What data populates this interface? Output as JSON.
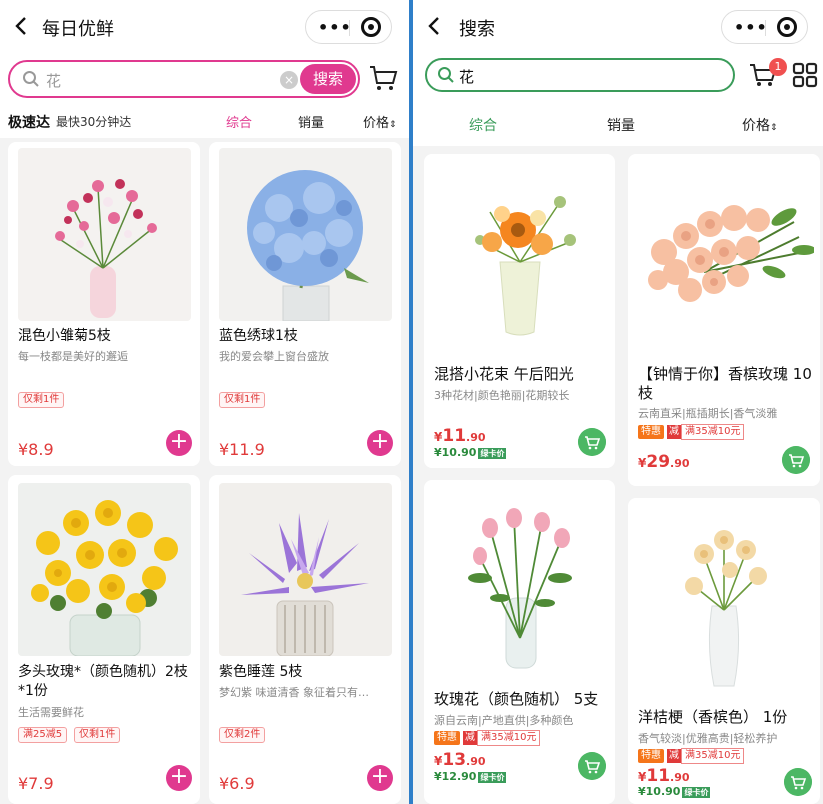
{
  "left": {
    "title": "每日优鲜",
    "search": {
      "value": "花",
      "button": "搜索"
    },
    "delivery": {
      "name": "极速达",
      "sub": "最快30分钟达"
    },
    "sort": [
      "综合",
      "销量",
      "价格"
    ],
    "colors": {
      "accent": "#e0398f"
    },
    "products": [
      {
        "name": "混色小雏菊5枝",
        "desc": "每一枝都是美好的邂逅",
        "tags": [
          "仅剩1件"
        ],
        "price": "¥8.9"
      },
      {
        "name": "蓝色绣球1枝",
        "desc": "我的爱会攀上窗台盛放",
        "tags": [
          "仅剩1件"
        ],
        "price": "¥11.9"
      },
      {
        "name": "多头玫瑰*（颜色随机）2枝*1份",
        "desc": "生活需要鲜花",
        "tags": [
          "满25减5",
          "仅剩1件"
        ],
        "price": "¥7.9"
      },
      {
        "name": "紫色睡莲 5枝",
        "desc": "梦幻紫 味道清香 象征着只有…",
        "tags": [
          "仅剩2件"
        ],
        "price": "¥6.9"
      }
    ]
  },
  "right": {
    "title": "搜索",
    "search": {
      "value": "花"
    },
    "cart_count": "1",
    "sort": [
      "综合",
      "销量",
      "价格"
    ],
    "colors": {
      "accent": "#3a9c5a"
    },
    "products": [
      {
        "name": "混搭小花束 午后阳光",
        "desc": "3种花材|颜色艳丽|花期较长",
        "price_int": "11",
        "price_dec": ".90",
        "member": "¥10.90",
        "member_label": "绿卡价"
      },
      {
        "name": "【钟情于你】香槟玫瑰 10枝",
        "desc": "云南直采|瓶插期长|香气淡雅",
        "promo": [
          "特惠",
          "减",
          "满35减10元"
        ],
        "price_int": "29",
        "price_dec": ".90"
      },
      {
        "name": "玫瑰花（颜色随机） 5支",
        "desc": "源自云南|产地直供|多种颜色",
        "promo": [
          "特惠",
          "减",
          "满35减10元"
        ],
        "price_int": "13",
        "price_dec": ".90",
        "member": "¥12.90",
        "member_label": "绿卡价"
      },
      {
        "name": "洋桔梗（香槟色） 1份",
        "desc": "香气较淡|优雅高贵|轻松养护",
        "promo": [
          "特惠",
          "减",
          "满35减10元"
        ],
        "price_int": "11",
        "price_dec": ".90",
        "member": "¥10.90",
        "member_label": "绿卡价"
      }
    ]
  }
}
